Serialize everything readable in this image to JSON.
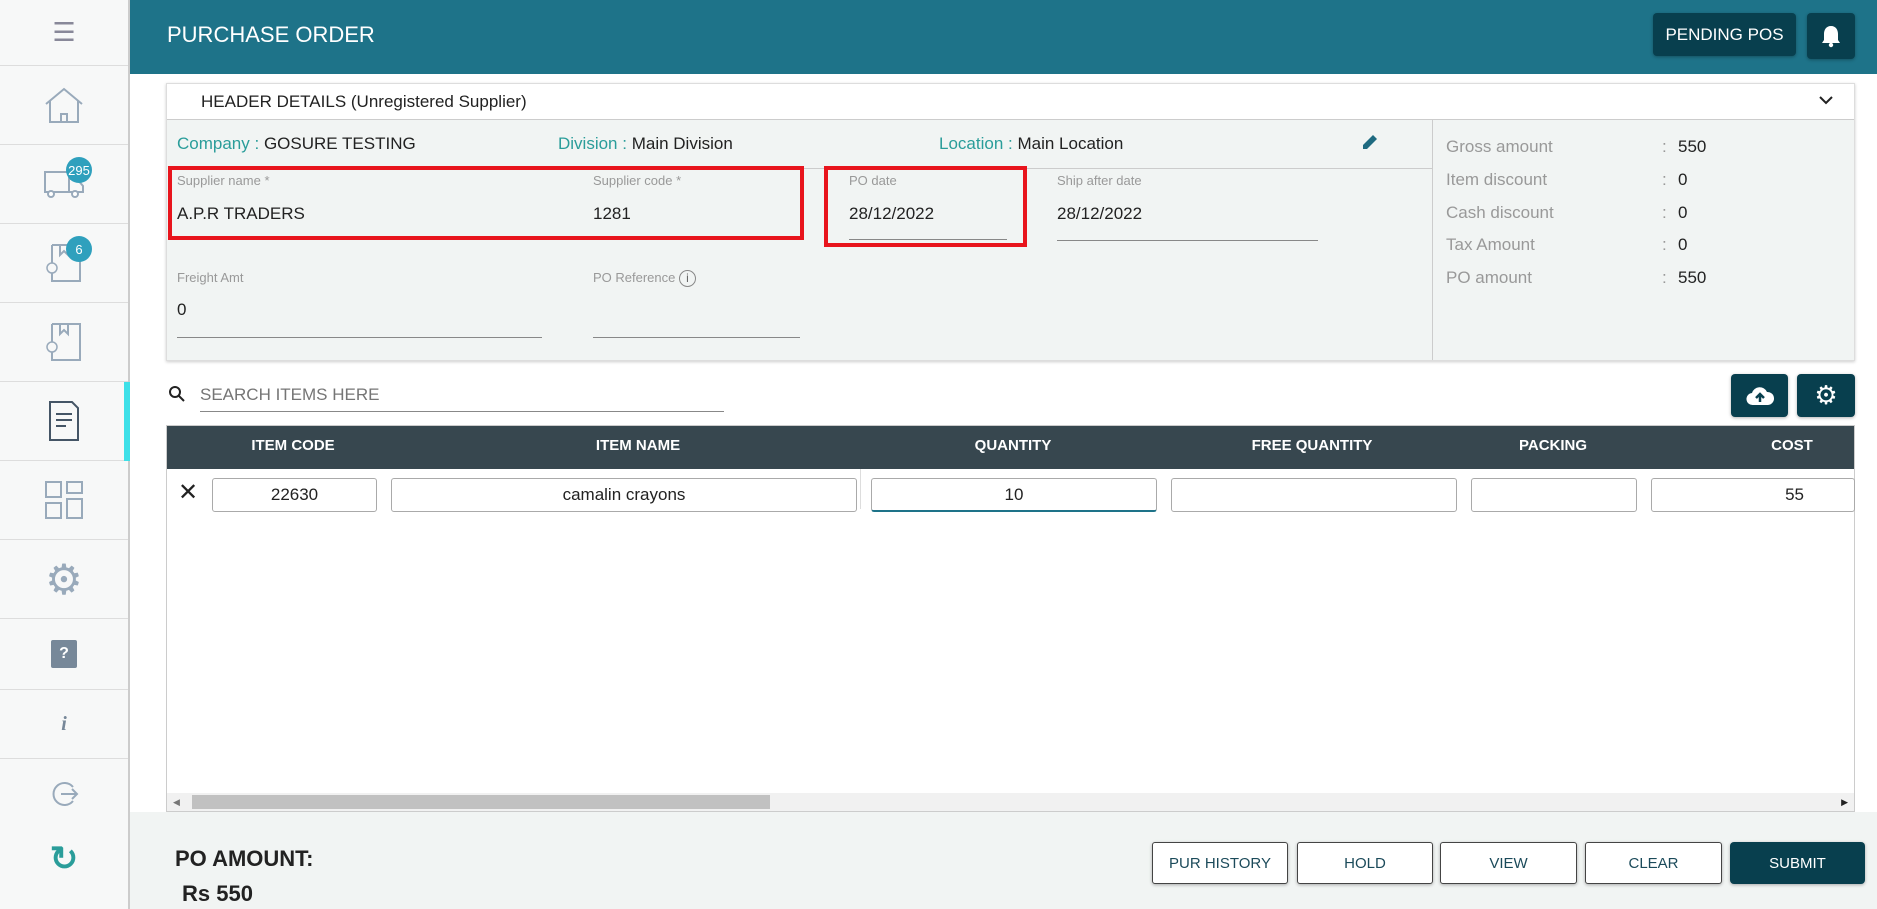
{
  "header": {
    "title": "PURCHASE ORDER",
    "pending_label": "PENDING POS"
  },
  "sidebar": {
    "badges": {
      "deliveries": "295",
      "received": "6"
    }
  },
  "card": {
    "title": "HEADER DETAILS (Unregistered Supplier)",
    "company_label": "Company :",
    "company": "GOSURE TESTING",
    "division_label": "Division :",
    "division": "Main Division",
    "location_label": "Location :",
    "location": "Main Location",
    "fields": {
      "supplier_name_label": "Supplier name",
      "supplier_name": "A.P.R TRADERS",
      "supplier_code_label": "Supplier code",
      "supplier_code": "1281",
      "po_date_label": "PO date",
      "po_date": "28/12/2022",
      "ship_after_label": "Ship after date",
      "ship_after": "28/12/2022",
      "freight_label": "Freight Amt",
      "freight": "0",
      "po_ref_label": "PO Reference",
      "po_ref": ""
    },
    "summary": [
      {
        "label": "Gross amount",
        "value": "550"
      },
      {
        "label": "Item discount",
        "value": "0"
      },
      {
        "label": "Cash discount",
        "value": "0"
      },
      {
        "label": "Tax Amount",
        "value": "0"
      },
      {
        "label": "PO amount",
        "value": "550"
      }
    ]
  },
  "search": {
    "placeholder": "SEARCH ITEMS HERE"
  },
  "table": {
    "columns": [
      "ITEM CODE",
      "ITEM NAME",
      "QUANTITY",
      "FREE QUANTITY",
      "PACKING",
      "COST"
    ],
    "rows": [
      {
        "code": "22630",
        "name": "camalin crayons",
        "quantity": "10",
        "free": "",
        "packing": "",
        "cost": "55"
      }
    ]
  },
  "footer": {
    "po_amount_label": "PO AMOUNT:",
    "po_amount": "Rs 550",
    "buttons": {
      "history": "PUR HISTORY",
      "hold": "HOLD",
      "view": "VIEW",
      "clear": "CLEAR",
      "submit": "SUBMIT"
    }
  },
  "colors": {
    "topbar": "#1e7389",
    "dark": "#083f4e",
    "accent": "#2a9d9a",
    "highlight": "#e8141c"
  }
}
